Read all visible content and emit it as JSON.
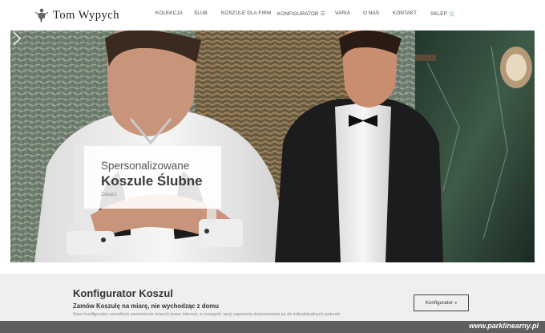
{
  "brand": {
    "name": "Tom Wypych",
    "logo_icon": "tailor-figure-icon"
  },
  "nav": {
    "items": [
      {
        "label": "KOLEKCJA"
      },
      {
        "label": "ŚLUB"
      },
      {
        "label": "KOSZULE DLA FIRM"
      },
      {
        "label": "KONFIGURATOR",
        "icon": "menu-lines-icon",
        "glyph": "☰"
      },
      {
        "label": "VARIA"
      },
      {
        "label": "O NAS"
      },
      {
        "label": "KONTAKT"
      },
      {
        "label": "SKLEP",
        "icon": "cart-icon",
        "glyph": "🛒"
      }
    ]
  },
  "hero": {
    "kicker": "Spersonalizowane",
    "title": "Koszule Ślubne",
    "link": "Zobacz",
    "next_icon": "chevron-right-icon"
  },
  "configurator": {
    "title": "Konfigurator Koszul",
    "subtitle": "Zamów Koszulę na miarę, nie wychodząc z domu",
    "description": "Nasz konfigurator umożliwia zamówienie koszuli przez internet, a mnogość opcji zapewnia dopasowanie jej do indywidualnych potrzeb",
    "button_label": "Konfigurator »"
  },
  "watermark": {
    "text": "www.parklinearny.pl"
  },
  "colors": {
    "header_bg": "#ffffff",
    "band_bg": "#efefef",
    "watermark_bg": "#5f5f5f",
    "text_dark": "#333333"
  }
}
